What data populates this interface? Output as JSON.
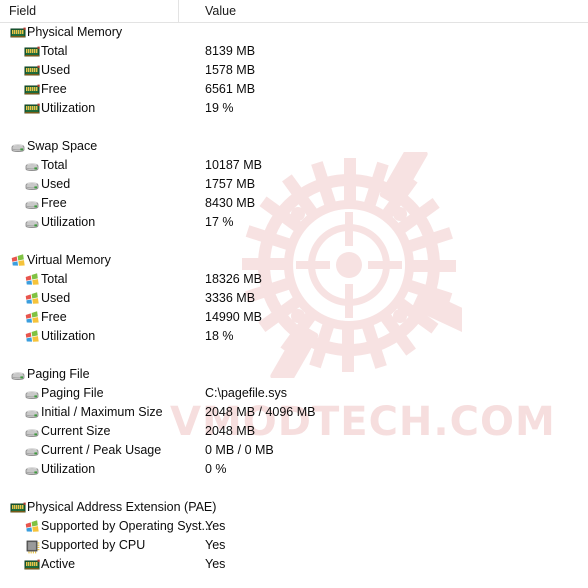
{
  "header": {
    "field_label": "Field",
    "value_label": "Value"
  },
  "watermark": {
    "text": "VMODTECH.COM",
    "logo_name": "vmodtech-gear-logo",
    "color": "#f6dede"
  },
  "colors": {
    "text": "#0c0c0c",
    "divider": "#e3e3e3",
    "background": "#ffffff",
    "ram_icon_green": "#1e6b3a",
    "ram_icon_pins": "#e8c44a",
    "disk_icon_gray": "#c9c9c9",
    "disk_icon_led": "#3f9b3f",
    "cpu_icon_gray": "#6f6f6f",
    "win_flag_red": "#e8554d",
    "win_flag_green": "#7fc242",
    "win_flag_blue": "#3b9ede",
    "win_flag_yellow": "#f5c33b"
  },
  "rows": [
    {
      "kind": "item",
      "level": 0,
      "icon": "ram-icon",
      "label": "Physical Memory",
      "value": ""
    },
    {
      "kind": "item",
      "level": 1,
      "icon": "ram-icon",
      "label": "Total",
      "value": "8139 MB"
    },
    {
      "kind": "item",
      "level": 1,
      "icon": "ram-icon",
      "label": "Used",
      "value": "1578 MB"
    },
    {
      "kind": "item",
      "level": 1,
      "icon": "ram-icon",
      "label": "Free",
      "value": "6561 MB"
    },
    {
      "kind": "item",
      "level": 1,
      "icon": "ram-icon",
      "label": "Utilization",
      "value": "19 %"
    },
    {
      "kind": "spacer"
    },
    {
      "kind": "item",
      "level": 0,
      "icon": "disk-icon",
      "label": "Swap Space",
      "value": ""
    },
    {
      "kind": "item",
      "level": 1,
      "icon": "disk-icon",
      "label": "Total",
      "value": "10187 MB"
    },
    {
      "kind": "item",
      "level": 1,
      "icon": "disk-icon",
      "label": "Used",
      "value": "1757 MB"
    },
    {
      "kind": "item",
      "level": 1,
      "icon": "disk-icon",
      "label": "Free",
      "value": "8430 MB"
    },
    {
      "kind": "item",
      "level": 1,
      "icon": "disk-icon",
      "label": "Utilization",
      "value": "17 %"
    },
    {
      "kind": "spacer"
    },
    {
      "kind": "item",
      "level": 0,
      "icon": "windows-flag-icon",
      "label": "Virtual Memory",
      "value": ""
    },
    {
      "kind": "item",
      "level": 1,
      "icon": "windows-flag-icon",
      "label": "Total",
      "value": "18326 MB"
    },
    {
      "kind": "item",
      "level": 1,
      "icon": "windows-flag-icon",
      "label": "Used",
      "value": "3336 MB"
    },
    {
      "kind": "item",
      "level": 1,
      "icon": "windows-flag-icon",
      "label": "Free",
      "value": "14990 MB"
    },
    {
      "kind": "item",
      "level": 1,
      "icon": "windows-flag-icon",
      "label": "Utilization",
      "value": "18 %"
    },
    {
      "kind": "spacer"
    },
    {
      "kind": "item",
      "level": 0,
      "icon": "disk-icon",
      "label": "Paging File",
      "value": ""
    },
    {
      "kind": "item",
      "level": 1,
      "icon": "disk-icon",
      "label": "Paging File",
      "value": "C:\\pagefile.sys"
    },
    {
      "kind": "item",
      "level": 1,
      "icon": "disk-icon",
      "label": "Initial / Maximum Size",
      "value": "2048 MB / 4096 MB"
    },
    {
      "kind": "item",
      "level": 1,
      "icon": "disk-icon",
      "label": "Current Size",
      "value": "2048 MB"
    },
    {
      "kind": "item",
      "level": 1,
      "icon": "disk-icon",
      "label": "Current / Peak Usage",
      "value": "0 MB / 0 MB"
    },
    {
      "kind": "item",
      "level": 1,
      "icon": "disk-icon",
      "label": "Utilization",
      "value": "0 %"
    },
    {
      "kind": "spacer"
    },
    {
      "kind": "item",
      "level": 0,
      "icon": "ram-icon",
      "label": "Physical Address Extension (PAE)",
      "value": ""
    },
    {
      "kind": "item",
      "level": 1,
      "icon": "windows-flag-icon",
      "label": "Supported by Operating Syst...",
      "value": "Yes"
    },
    {
      "kind": "item",
      "level": 1,
      "icon": "cpu-icon",
      "label": "Supported by CPU",
      "value": "Yes"
    },
    {
      "kind": "item",
      "level": 1,
      "icon": "ram-icon",
      "label": "Active",
      "value": "Yes"
    }
  ]
}
